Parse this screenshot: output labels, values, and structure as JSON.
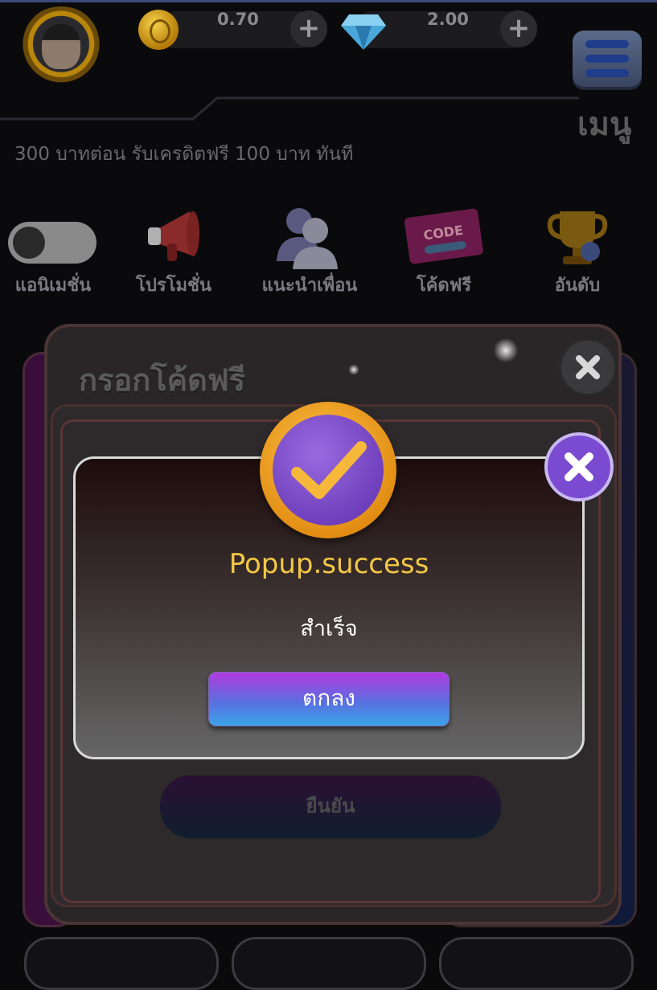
{
  "header": {
    "coin_balance": "0.70",
    "gem_balance": "2.00",
    "menu_label": "เมนู",
    "announcement": "300 บาทต่อน รับเครดิตฟรี 100 บาท ทันที"
  },
  "quick_actions": [
    {
      "label": "แอนิเมชั่น",
      "icon": "toggle"
    },
    {
      "label": "โปรโมชั่น",
      "icon": "megaphone-icon"
    },
    {
      "label": "แนะนำเพื่อน",
      "icon": "friends-icon"
    },
    {
      "label": "โค้ดฟรี",
      "icon": "code-ticket-icon"
    },
    {
      "label": "อันดับ",
      "icon": "trophy-icon"
    }
  ],
  "code_icon_text": "CODE",
  "code_modal": {
    "title": "กรอกโค้ดฟรี",
    "confirm_label": "ยืนยัน"
  },
  "success_popup": {
    "title": "Popup.success",
    "message": "สำเร็จ",
    "ok_label": "ตกลง"
  },
  "colors": {
    "accent_yellow": "#f3c845",
    "button_gradient_top": "#b03ae0",
    "button_gradient_bottom": "#3aa4e8",
    "close_purple": "#7a4ad0"
  }
}
